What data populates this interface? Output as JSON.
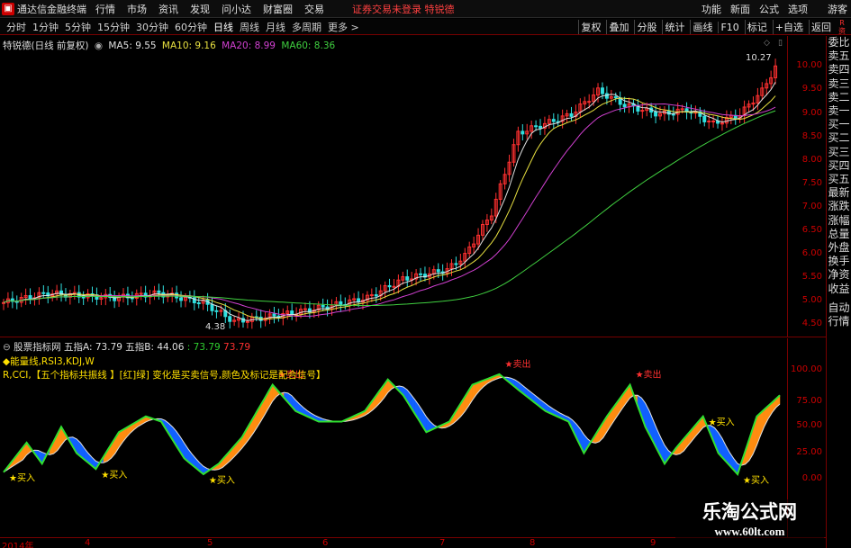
{
  "menubar": {
    "app_title": "通达信金融终端",
    "items": [
      "行情",
      "市场",
      "资讯",
      "发现",
      "问小达",
      "财富圈",
      "交易"
    ],
    "notice": "证券交易未登录  特锐德",
    "right_items": [
      "功能",
      "新面",
      "公式",
      "选项",
      "游客"
    ]
  },
  "periodbar": {
    "items": [
      "分时",
      "1分钟",
      "5分钟",
      "15分钟",
      "30分钟",
      "60分钟",
      "日线",
      "周线",
      "月线",
      "多周期",
      "更多 >"
    ],
    "active": "日线",
    "right_items": [
      "复权",
      "叠加",
      "分股",
      "统计",
      "画线",
      "F10",
      "标记",
      "+自选",
      "返回"
    ],
    "corner": "R 资"
  },
  "main_chart": {
    "stock_label": "特锐德(日线 前复权)",
    "ma": [
      {
        "label": "MA5: 9.55",
        "color": "#e0e0e0"
      },
      {
        "label": "MA10: 9.16",
        "color": "#e8e040"
      },
      {
        "label": "MA20: 8.99",
        "color": "#d040d0"
      },
      {
        "label": "MA60: 8.36",
        "color": "#40d040"
      }
    ],
    "high_label": "10.27",
    "low_label": "4.38",
    "y_ticks": [
      "10.00",
      "9.50",
      "9.00",
      "8.50",
      "8.00",
      "7.50",
      "7.00",
      "6.50",
      "6.00",
      "5.50",
      "5.00",
      "4.50"
    ]
  },
  "indicator": {
    "title": "股票指标网",
    "line_a_label": "五指A: 73.79",
    "line_b_label": "五指B: 44.06",
    "val1": ": 73.79",
    "val2": "73.79",
    "note1": "◆能量线,RSI3,KDJ,W",
    "note2": "R,CCI,【五个指标共振线 】[红]绿] 变化是买卖信号,颜色及标记是配合信号】",
    "y_ticks": [
      "100.00",
      "75.00",
      "50.00",
      "25.00",
      "0.00"
    ],
    "signals": [
      {
        "type": "buy",
        "label": "买入"
      },
      {
        "type": "buy",
        "label": "买入"
      },
      {
        "type": "buy",
        "label": "买入"
      },
      {
        "type": "sell",
        "label": "卖出"
      },
      {
        "type": "sell",
        "label": "卖出"
      },
      {
        "type": "sell",
        "label": "卖出"
      },
      {
        "type": "buy",
        "label": "买入"
      },
      {
        "type": "buy",
        "label": "买入"
      }
    ]
  },
  "x_axis": [
    "2014年",
    "4",
    "5",
    "6",
    "7",
    "8",
    "9"
  ],
  "sidebar": [
    "委比",
    "卖五",
    "卖四",
    "卖三",
    "卖二",
    "卖一",
    "买一",
    "买二",
    "买三",
    "买四",
    "买五",
    "最新",
    "涨跌",
    "涨幅",
    "总量",
    "外盘",
    "换手",
    "净资",
    "收益",
    "自动",
    "行情"
  ],
  "watermark": {
    "title": "乐淘公式网",
    "url": "www.60lt.com"
  },
  "colors": {
    "up": "#ff3030",
    "down": "#30e0e0",
    "ma5": "#e0e0e0",
    "ma10": "#e8e040",
    "ma20": "#d040d0",
    "ma60": "#40d040",
    "fill_orange": "#ff8c10",
    "fill_blue": "#1060ff",
    "axis": "#cc0000"
  }
}
